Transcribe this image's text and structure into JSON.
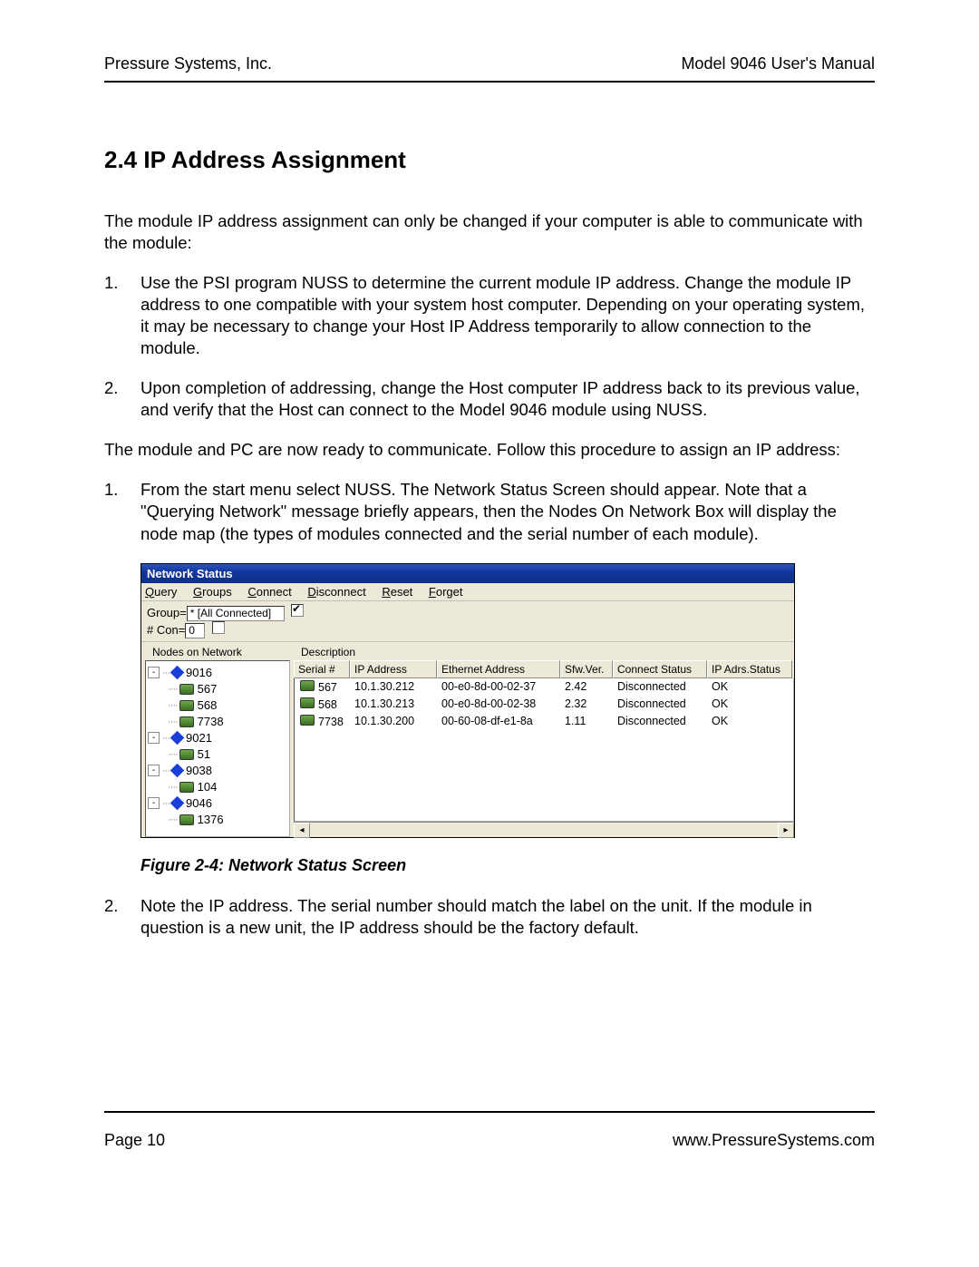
{
  "header": {
    "left": "Pressure Systems, Inc.",
    "right": "Model 9046 User's Manual"
  },
  "section_title": "2.4  IP Address Assignment",
  "intro": "The module IP address assignment can only be changed if your computer is able to communicate with the module:",
  "listA": [
    {
      "n": "1.",
      "t": "Use the PSI program NUSS to determine the current module IP address. Change the module IP address to one compatible with your system host computer. Depending on your operating system, it may be necessary to change your Host IP Address temporarily to allow connection to the module."
    },
    {
      "n": "2.",
      "t": "Upon completion of addressing, change the Host computer IP address back to its previous value, and verify that the Host can connect to the Model 9046 module using NUSS."
    }
  ],
  "mid": "The module and PC are now ready to communicate. Follow this procedure to assign an IP address:",
  "listB": [
    {
      "n": "1.",
      "t": "From the start menu select NUSS. The Network Status Screen should appear. Note that a \"Querying Network\" message briefly appears, then the Nodes On Network Box will display the node map (the types of modules connected and the serial number of each module)."
    }
  ],
  "window": {
    "title": "Network Status",
    "menus": [
      "Query",
      "Groups",
      "Connect",
      "Disconnect",
      "Reset",
      "Forget"
    ],
    "group_label": "Group=",
    "group_value": "* [All Connected]",
    "con_label": "# Con=",
    "con_value": "0",
    "nodes_label": "Nodes on Network",
    "desc_label": "Description",
    "tree": [
      {
        "lvl": 0,
        "pm": "-",
        "type": "dia",
        "label": "9016"
      },
      {
        "lvl": 1,
        "pm": "",
        "type": "mod",
        "label": "567"
      },
      {
        "lvl": 1,
        "pm": "",
        "type": "mod",
        "label": "568"
      },
      {
        "lvl": 1,
        "pm": "",
        "type": "mod",
        "label": "7738"
      },
      {
        "lvl": 0,
        "pm": "-",
        "type": "dia",
        "label": "9021"
      },
      {
        "lvl": 1,
        "pm": "",
        "type": "mod",
        "label": "51"
      },
      {
        "lvl": 0,
        "pm": "-",
        "type": "dia",
        "label": "9038"
      },
      {
        "lvl": 1,
        "pm": "",
        "type": "mod",
        "label": "104"
      },
      {
        "lvl": 0,
        "pm": "-",
        "type": "dia",
        "label": "9046"
      },
      {
        "lvl": 1,
        "pm": "",
        "type": "mod",
        "label": "1376"
      }
    ],
    "columns": [
      "Serial #",
      "IP Address",
      "Ethernet Address",
      "Sfw.Ver.",
      "Connect Status",
      "IP Adrs.Status"
    ],
    "rows": [
      {
        "serial": "567",
        "ip": "10.1.30.212",
        "eth": "00-e0-8d-00-02-37",
        "sfw": "2.42",
        "conn": "Disconnected",
        "stat": "OK"
      },
      {
        "serial": "568",
        "ip": "10.1.30.213",
        "eth": "00-e0-8d-00-02-38",
        "sfw": "2.32",
        "conn": "Disconnected",
        "stat": "OK"
      },
      {
        "serial": "7738",
        "ip": "10.1.30.200",
        "eth": "00-60-08-df-e1-8a",
        "sfw": "1.11",
        "conn": "Disconnected",
        "stat": "OK"
      }
    ]
  },
  "caption": "Figure 2-4:  Network Status Screen",
  "listC": [
    {
      "n": "2.",
      "t": "Note the IP address. The serial number should match the label on the unit. If the module in question is a new unit, the IP address should be the factory default."
    }
  ],
  "footer": {
    "left": "Page 10",
    "right": "www.PressureSystems.com"
  }
}
